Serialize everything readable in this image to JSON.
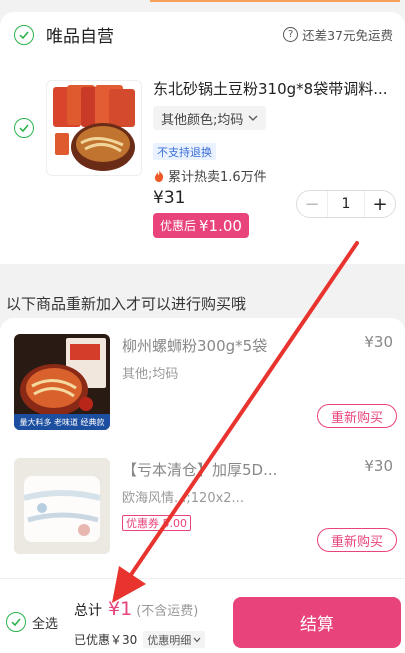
{
  "store": {
    "name": "唯品自营",
    "shipping_note": "还差37元免运费"
  },
  "item1": {
    "title": "东北砂锅土豆粉310g*8袋带调料...",
    "spec": "其他颜色;均码",
    "no_return": "不支持退换",
    "hot_sales": "累计热卖1.6万件",
    "price": "¥31",
    "discount_label": "优惠后",
    "discount_price": "¥1.00",
    "quantity": "1"
  },
  "readd_section": {
    "title": "以下商品重新加入才可以进行购买哦"
  },
  "item2": {
    "title": "柳州螺蛳粉300g*5袋",
    "spec": "其他;均码",
    "price": "¥30",
    "rebuy": "重新购买",
    "thumb_caption": "量大料多 老味道 经典款"
  },
  "item3": {
    "title": "【亏本清仓】加厚5D...",
    "spec": "欧海风情...;120x2...",
    "coupon": "优惠券 5.00",
    "price": "¥30",
    "rebuy": "重新购买"
  },
  "bottom": {
    "select_all": "全选",
    "total_label": "总计",
    "total_amount": "¥1",
    "shipping_excl": "(不含运费)",
    "saved": "已优惠￥30",
    "detail": "优惠明细",
    "checkout": "结算"
  },
  "colors": {
    "accent": "#e8437a",
    "check_green": "#2bb24c",
    "annotation_arrow": "#e8332e"
  }
}
